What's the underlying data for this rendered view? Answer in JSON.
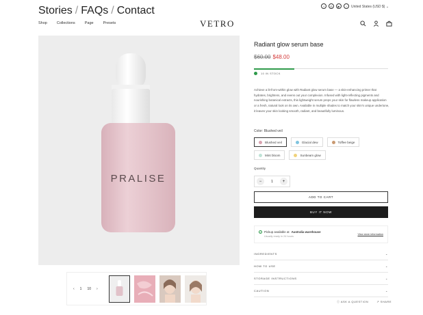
{
  "topbar": {
    "links": [
      "Stories",
      "FAQs",
      "Contact"
    ],
    "socials": [
      "facebook-icon",
      "instagram-icon",
      "youtube-icon",
      "tiktok-icon"
    ],
    "locale": "United States (USD $)"
  },
  "header": {
    "nav": [
      "Shop",
      "Collections",
      "Page",
      "Presets"
    ],
    "logo": "VETRO"
  },
  "gallery": {
    "bottle_label": "PRALISE",
    "pager": {
      "prev": "‹",
      "current": "1",
      "total": "10",
      "next": "›"
    }
  },
  "product": {
    "title": "Radiant glow serum base",
    "old_price": "$60.00",
    "new_price": "$48.00",
    "stock_text": "10 IN STOCK",
    "stock_fraction": 0.3,
    "description": "Achieve a lit-from-within glow with Radiant glow serum base — a skin-enhancing primer that hydrates, brightens, and evens out your complexion. Infused with light-reflecting pigments and nourishing botanical extracts, this lightweight serum preps your skin for flawless makeup application or a fresh, natural look on its own. Available in multiple shades to match your skin's unique undertone, it leaves your skin looking smooth, radiant, and beautifully luminous.",
    "color_label": "Color: Blushed veil",
    "swatches": [
      {
        "name": "Blushed veil",
        "color": "#d9a3b0",
        "selected": true
      },
      {
        "name": "Glacial dew",
        "color": "#7fc4df",
        "selected": false
      },
      {
        "name": "Toffee beige",
        "color": "#c99a72",
        "selected": false
      },
      {
        "name": "Mint bloom",
        "color": "#bfe3d6",
        "selected": false
      },
      {
        "name": "Sunbeam glow",
        "color": "#f0d27a",
        "selected": false
      }
    ],
    "quantity_label": "Quantity",
    "quantity": "1",
    "minus": "−",
    "plus": "+",
    "add_to_cart": "ADD TO CART",
    "buy_now": "BUY IT NOW",
    "pickup": {
      "prefix": "Pickup available at",
      "location": "Australia warehouse",
      "sub": "Usually ready in 24 hours",
      "store_link": "View store information"
    },
    "accordions": [
      "INGREDIENTS",
      "HOW TO USE",
      "STORAGE INSTRUCTIONS",
      "CAUTION"
    ],
    "ask_question": "ASK A QUESTION",
    "share": "SHARE"
  },
  "colors": {
    "accent": "#2e9a4a",
    "sale": "#d43a3a",
    "bottle": "#e6c3cb"
  }
}
